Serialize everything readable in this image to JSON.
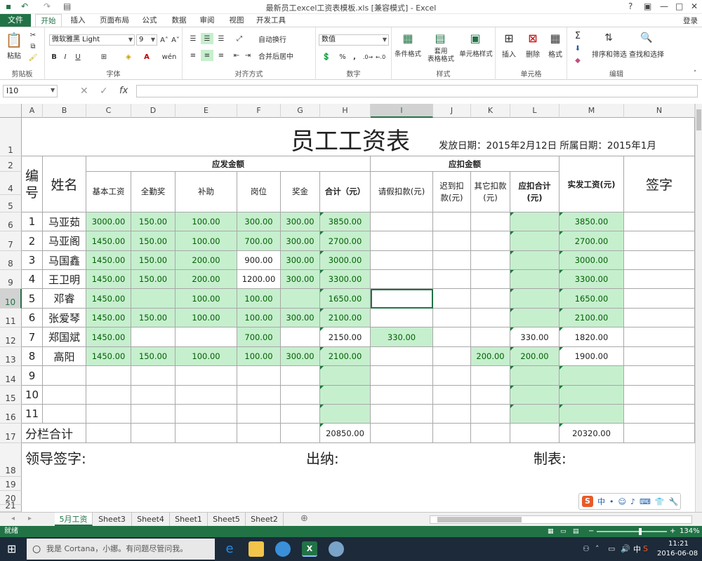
{
  "window": {
    "title": "最新员工excel工资表模板.xls  [兼容模式] - Excel",
    "help": "?",
    "ribbon_display": "▣",
    "minimize": "—",
    "maximize": "□",
    "close": "✕"
  },
  "ribbon_tabs": [
    "文件",
    "开始",
    "插入",
    "页面布局",
    "公式",
    "数据",
    "审阅",
    "视图",
    "开发工具"
  ],
  "login": "登录",
  "ribbon": {
    "clipboard": {
      "paste": "粘贴",
      "label": "剪贴板"
    },
    "font": {
      "name": "微软雅黑 Light",
      "size": "9",
      "grow": "A˄",
      "shrink": "A˅",
      "bold": "B",
      "italic": "I",
      "underline": "U",
      "wen": "wén",
      "label": "字体"
    },
    "alignment": {
      "wrap": "自动换行",
      "merge": "合并后居中",
      "label": "对齐方式"
    },
    "number": {
      "format": "数值",
      "percent": "%",
      "comma": ",",
      "label": "数字"
    },
    "styles": {
      "conditional": "条件格式",
      "table_format": "套用\n表格格式",
      "cell_styles": "单元格样式",
      "label": "样式"
    },
    "cells": {
      "insert": "插入",
      "delete": "删除",
      "format": "格式",
      "label": "单元格"
    },
    "editing": {
      "sort": "排序和筛选",
      "find": "查找和选择",
      "label": "编辑"
    }
  },
  "formula_bar": {
    "name_box": "I10",
    "fx": "fx",
    "value": ""
  },
  "columns": [
    "A",
    "B",
    "C",
    "D",
    "E",
    "F",
    "G",
    "H",
    "I",
    "J",
    "K",
    "L",
    "M",
    "N"
  ],
  "selected_column": "I",
  "rows": [
    "1",
    "2",
    "4",
    "5",
    "6",
    "7",
    "8",
    "9",
    "10",
    "11",
    "12",
    "13",
    "14",
    "15",
    "16",
    "17",
    "18",
    "19",
    "20",
    "21"
  ],
  "selected_row": "10",
  "sheet": {
    "title": "员工工资表",
    "date_info": "发放日期：2015年2月12日 所属日期：2015年1月",
    "hdr_no": "编\n号",
    "hdr_name": "姓名",
    "hdr_payable": "应发金额",
    "hdr_deduct": "应扣金额",
    "hdr_net": "实发工资(元)",
    "hdr_sign": "签字",
    "sub_headers": [
      "基本工资",
      "全勤奖",
      "补助",
      "岗位",
      "奖金",
      "合计（元）",
      "请假扣款(元)",
      "迟到扣\n款(元)",
      "其它扣款\n(元)",
      "应扣合计\n(元)"
    ],
    "data": [
      [
        "1",
        "马亚茹",
        "3000.00",
        "150.00",
        "100.00",
        "300.00",
        "300.00",
        "3850.00",
        "",
        "",
        "",
        "",
        "3850.00",
        ""
      ],
      [
        "2",
        "马亚阁",
        "1450.00",
        "150.00",
        "100.00",
        "700.00",
        "300.00",
        "2700.00",
        "",
        "",
        "",
        "",
        "2700.00",
        ""
      ],
      [
        "3",
        "马国鑫",
        "1450.00",
        "150.00",
        "200.00",
        "900.00",
        "300.00",
        "3000.00",
        "",
        "",
        "",
        "",
        "3000.00",
        ""
      ],
      [
        "4",
        "王卫明",
        "1450.00",
        "150.00",
        "200.00",
        "1200.00",
        "300.00",
        "3300.00",
        "",
        "",
        "",
        "",
        "3300.00",
        ""
      ],
      [
        "5",
        "邓睿",
        "1450.00",
        "",
        "100.00",
        "100.00",
        "",
        "1650.00",
        "",
        "",
        "",
        "",
        "1650.00",
        ""
      ],
      [
        "6",
        "张爱琴",
        "1450.00",
        "150.00",
        "100.00",
        "100.00",
        "300.00",
        "2100.00",
        "",
        "",
        "",
        "",
        "2100.00",
        ""
      ],
      [
        "7",
        "郑国斌",
        "1450.00",
        "",
        "",
        "700.00",
        "",
        "2150.00",
        "330.00",
        "",
        "",
        "330.00",
        "1820.00",
        ""
      ],
      [
        "8",
        "高阳",
        "1450.00",
        "150.00",
        "100.00",
        "100.00",
        "300.00",
        "2100.00",
        "",
        "",
        "200.00",
        "200.00",
        "1900.00",
        ""
      ],
      [
        "9",
        "",
        "",
        "",
        "",
        "",
        "",
        "",
        "",
        "",
        "",
        "",
        "",
        ""
      ],
      [
        "10",
        "",
        "",
        "",
        "",
        "",
        "",
        "",
        "",
        "",
        "",
        "",
        "",
        ""
      ],
      [
        "11",
        "",
        "",
        "",
        "",
        "",
        "",
        "",
        "",
        "",
        "",
        "",
        "",
        ""
      ]
    ],
    "subtotal_label": "分栏合计",
    "subtotal_h": "20850.00",
    "subtotal_m": "20320.00",
    "footer_leader": "领导签字:",
    "footer_cashier": "出纳:",
    "footer_maker": "制表:"
  },
  "sheet_tabs": [
    "5月工资",
    "Sheet3",
    "Sheet4",
    "Sheet1",
    "Sheet5",
    "Sheet2"
  ],
  "status": {
    "ready": "就绪",
    "zoom": "134%"
  },
  "taskbar": {
    "cortana": "我是 Cortana，小娜。有问题尽管问我。",
    "time": "11:21",
    "date": "2016-06-08",
    "ime": "中"
  },
  "colors": {
    "excel_green": "#217346",
    "good_fill": "#c6efce",
    "good_text": "#006100"
  }
}
